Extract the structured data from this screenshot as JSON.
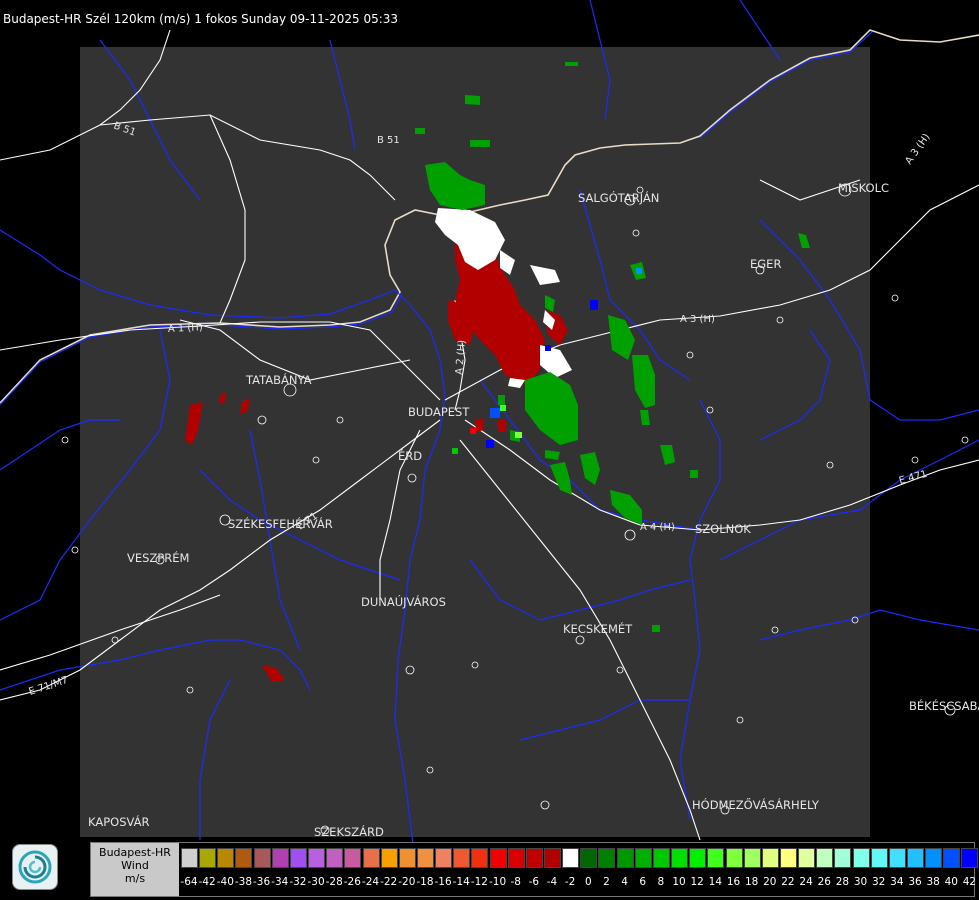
{
  "header": {
    "title": "Budapest-HR Szél 120km (m/s) 1 fokos Sunday 09-11-2025 05:33"
  },
  "colors": {
    "background": "#000000",
    "radar_area": "#333333",
    "roads": "#ffffff",
    "rivers_borders": "#1a2bff",
    "outflow_red": "#b20000",
    "inflow_green": "#00a000"
  },
  "icons": {
    "logo": "met-service-swirl-icon"
  },
  "map": {
    "cities": [
      {
        "id": "salgotarjan",
        "name": "SALGÓTARJÁN"
      },
      {
        "id": "miskolc",
        "name": "MISKOLC"
      },
      {
        "id": "eger",
        "name": "EGER"
      },
      {
        "id": "tatabanya",
        "name": "TATABÁNYA"
      },
      {
        "id": "budapest",
        "name": "BUDAPEST"
      },
      {
        "id": "erd",
        "name": "ÉRD"
      },
      {
        "id": "szekesfehervar",
        "name": "SZÉKESFEHÉRVÁR"
      },
      {
        "id": "veszprem",
        "name": "VESZPRÉM"
      },
      {
        "id": "szolnok",
        "name": "SZOLNOK"
      },
      {
        "id": "dunaujvaros",
        "name": "DUNAÚJVÁROS"
      },
      {
        "id": "kecskemet",
        "name": "KECSKEMÉT"
      },
      {
        "id": "bekescsaba",
        "name": "BÉKÉSCSABA"
      },
      {
        "id": "hodmezovasarhely",
        "name": "HÓDMEZŐVÁSÁRHELY"
      },
      {
        "id": "kaposvar",
        "name": "KAPOSVÁR"
      },
      {
        "id": "szekszard",
        "name": "SZEKSZÁRD"
      }
    ],
    "roads": [
      {
        "id": "b51-west",
        "name": "B 51"
      },
      {
        "id": "b51-north",
        "name": "B 51"
      },
      {
        "id": "a1",
        "name": "A 1 (H)"
      },
      {
        "id": "a2",
        "name": "A 2 (H)"
      },
      {
        "id": "a3",
        "name": "A 3 (H)"
      },
      {
        "id": "a3-ne",
        "name": "A 3 (H)"
      },
      {
        "id": "a4",
        "name": "A 4 (H)"
      },
      {
        "id": "e71",
        "name": "E 71"
      },
      {
        "id": "e71-sw",
        "name": "E 71/M7"
      },
      {
        "id": "e471",
        "name": "E 471"
      }
    ]
  },
  "legend": {
    "title_line1": "Budapest-HR",
    "title_line2": "Wind",
    "title_line3": "m/s",
    "ticks": [
      "-64",
      "-42",
      "-40",
      "-38",
      "-36",
      "-34",
      "-32",
      "-30",
      "-28",
      "-26",
      "-24",
      "-22",
      "-20",
      "-18",
      "-16",
      "-14",
      "-12",
      "-10",
      "-8",
      "-6",
      "-4",
      "-2",
      "0",
      "2",
      "4",
      "6",
      "8",
      "10",
      "12",
      "14",
      "16",
      "18",
      "20",
      "22",
      "24",
      "26",
      "28",
      "30",
      "32",
      "34",
      "36",
      "38",
      "40",
      "42"
    ],
    "colors": [
      "#cfcfcf",
      "#a8a800",
      "#b88800",
      "#b05a10",
      "#a85858",
      "#b040b0",
      "#a050f0",
      "#b860e0",
      "#c060c0",
      "#c85aa0",
      "#e87048",
      "#f8a000",
      "#f09030",
      "#f09040",
      "#f08060",
      "#f05830",
      "#f03010",
      "#f00000",
      "#d80000",
      "#c00000",
      "#b00000",
      "#ffffff",
      "#006800",
      "#008000",
      "#009800",
      "#00b000",
      "#00c800",
      "#00e000",
      "#00f000",
      "#40ff20",
      "#80ff40",
      "#a0ff60",
      "#e0ff80",
      "#ffff80",
      "#e0ffa0",
      "#c0ffc0",
      "#a0ffd8",
      "#80ffe8",
      "#60f8f8",
      "#40e0ff",
      "#20c0ff",
      "#0090ff",
      "#0050ff",
      "#0000ff"
    ]
  }
}
